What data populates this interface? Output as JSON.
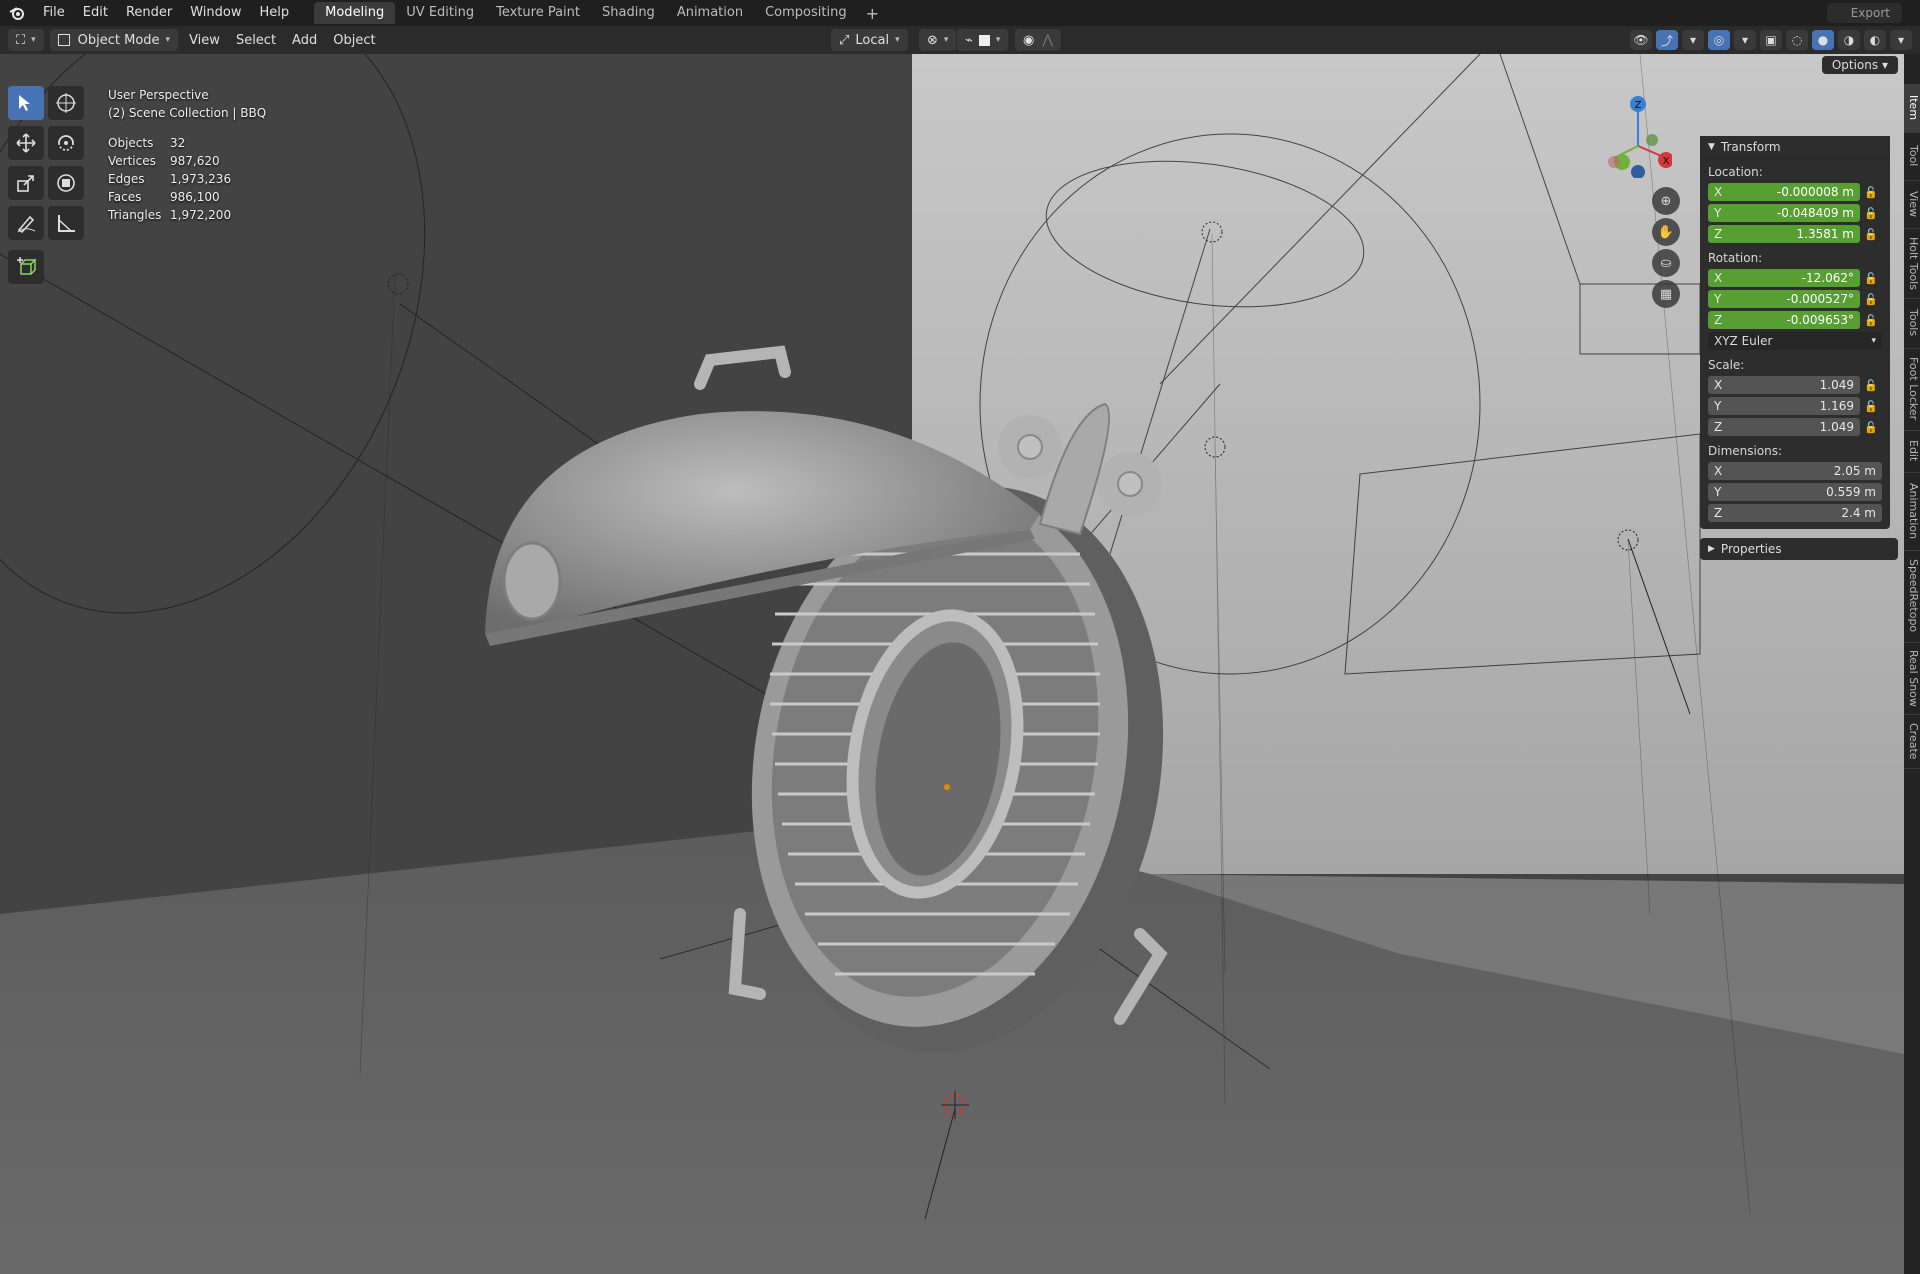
{
  "topbar": {
    "menus": [
      "File",
      "Edit",
      "Render",
      "Window",
      "Help"
    ],
    "workspaces": [
      "Modeling",
      "UV Editing",
      "Texture Paint",
      "Shading",
      "Animation",
      "Compositing"
    ],
    "active_workspace": "Modeling",
    "add_symbol": "+",
    "export_label": "Export"
  },
  "header": {
    "mode": "Object Mode",
    "menus": [
      "View",
      "Select",
      "Add",
      "Object"
    ],
    "transform_orientation": "Local",
    "options_label": "Options"
  },
  "viewport": {
    "view_name": "User Perspective",
    "collection": "(2) Scene Collection | BBQ",
    "stats": [
      {
        "label": "Objects",
        "value": "32"
      },
      {
        "label": "Vertices",
        "value": "987,620"
      },
      {
        "label": "Edges",
        "value": "1,973,236"
      },
      {
        "label": "Faces",
        "value": "986,100"
      },
      {
        "label": "Triangles",
        "value": "1,972,200"
      }
    ],
    "gizmo": {
      "z": "Z",
      "x": "X"
    }
  },
  "npanel": {
    "title": "Transform",
    "location_label": "Location:",
    "location": [
      {
        "axis": "X",
        "value": "-0.000008 m"
      },
      {
        "axis": "Y",
        "value": "-0.048409 m"
      },
      {
        "axis": "Z",
        "value": "1.3581 m"
      }
    ],
    "rotation_label": "Rotation:",
    "rotation": [
      {
        "axis": "X",
        "value": "-12.062°"
      },
      {
        "axis": "Y",
        "value": "-0.000527°"
      },
      {
        "axis": "Z",
        "value": "-0.009653°"
      }
    ],
    "rotation_mode": "XYZ Euler",
    "scale_label": "Scale:",
    "scale": [
      {
        "axis": "X",
        "value": "1.049"
      },
      {
        "axis": "Y",
        "value": "1.169"
      },
      {
        "axis": "Z",
        "value": "1.049"
      }
    ],
    "dimensions_label": "Dimensions:",
    "dimensions": [
      {
        "axis": "X",
        "value": "2.05 m"
      },
      {
        "axis": "Y",
        "value": "0.559 m"
      },
      {
        "axis": "Z",
        "value": "2.4 m"
      }
    ],
    "properties_label": "Properties"
  },
  "side_tabs": [
    "Item",
    "Tool",
    "View",
    "Holt Tools",
    "Tools",
    "Foot Locker",
    "Edit",
    "Animation",
    "SpeedRetopo",
    "Real Snow",
    "Create"
  ],
  "colors": {
    "accent": "#4772b3",
    "green_field": "#579e33"
  }
}
